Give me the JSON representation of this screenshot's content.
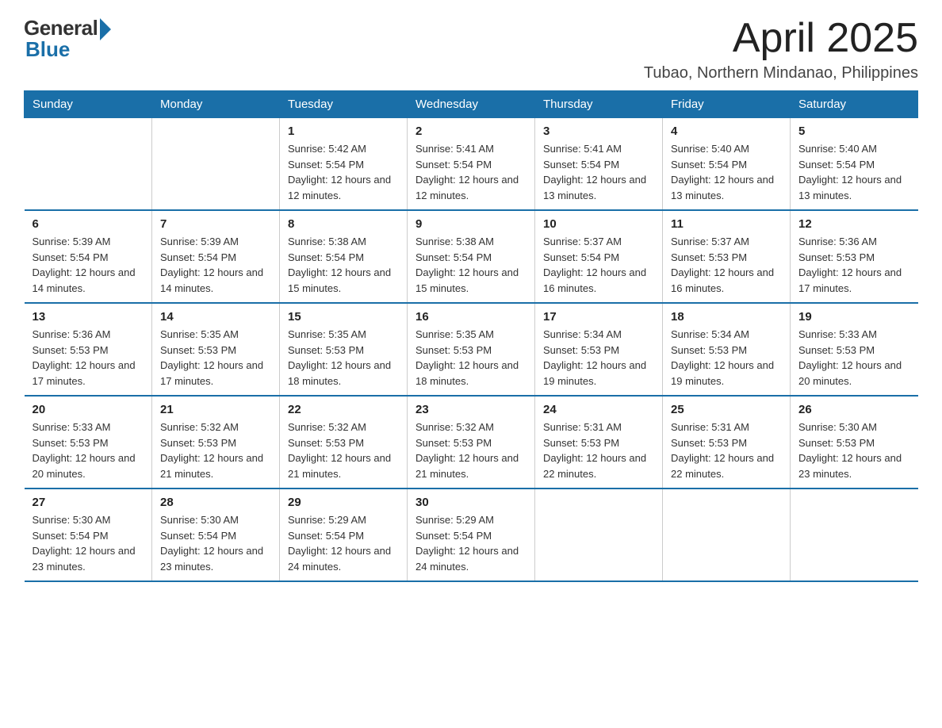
{
  "logo": {
    "general": "General",
    "blue": "Blue"
  },
  "header": {
    "title": "April 2025",
    "location": "Tubao, Northern Mindanao, Philippines"
  },
  "days_of_week": [
    "Sunday",
    "Monday",
    "Tuesday",
    "Wednesday",
    "Thursday",
    "Friday",
    "Saturday"
  ],
  "weeks": [
    [
      {
        "day": "",
        "sunrise": "",
        "sunset": "",
        "daylight": ""
      },
      {
        "day": "",
        "sunrise": "",
        "sunset": "",
        "daylight": ""
      },
      {
        "day": "1",
        "sunrise": "Sunrise: 5:42 AM",
        "sunset": "Sunset: 5:54 PM",
        "daylight": "Daylight: 12 hours and 12 minutes."
      },
      {
        "day": "2",
        "sunrise": "Sunrise: 5:41 AM",
        "sunset": "Sunset: 5:54 PM",
        "daylight": "Daylight: 12 hours and 12 minutes."
      },
      {
        "day": "3",
        "sunrise": "Sunrise: 5:41 AM",
        "sunset": "Sunset: 5:54 PM",
        "daylight": "Daylight: 12 hours and 13 minutes."
      },
      {
        "day": "4",
        "sunrise": "Sunrise: 5:40 AM",
        "sunset": "Sunset: 5:54 PM",
        "daylight": "Daylight: 12 hours and 13 minutes."
      },
      {
        "day": "5",
        "sunrise": "Sunrise: 5:40 AM",
        "sunset": "Sunset: 5:54 PM",
        "daylight": "Daylight: 12 hours and 13 minutes."
      }
    ],
    [
      {
        "day": "6",
        "sunrise": "Sunrise: 5:39 AM",
        "sunset": "Sunset: 5:54 PM",
        "daylight": "Daylight: 12 hours and 14 minutes."
      },
      {
        "day": "7",
        "sunrise": "Sunrise: 5:39 AM",
        "sunset": "Sunset: 5:54 PM",
        "daylight": "Daylight: 12 hours and 14 minutes."
      },
      {
        "day": "8",
        "sunrise": "Sunrise: 5:38 AM",
        "sunset": "Sunset: 5:54 PM",
        "daylight": "Daylight: 12 hours and 15 minutes."
      },
      {
        "day": "9",
        "sunrise": "Sunrise: 5:38 AM",
        "sunset": "Sunset: 5:54 PM",
        "daylight": "Daylight: 12 hours and 15 minutes."
      },
      {
        "day": "10",
        "sunrise": "Sunrise: 5:37 AM",
        "sunset": "Sunset: 5:54 PM",
        "daylight": "Daylight: 12 hours and 16 minutes."
      },
      {
        "day": "11",
        "sunrise": "Sunrise: 5:37 AM",
        "sunset": "Sunset: 5:53 PM",
        "daylight": "Daylight: 12 hours and 16 minutes."
      },
      {
        "day": "12",
        "sunrise": "Sunrise: 5:36 AM",
        "sunset": "Sunset: 5:53 PM",
        "daylight": "Daylight: 12 hours and 17 minutes."
      }
    ],
    [
      {
        "day": "13",
        "sunrise": "Sunrise: 5:36 AM",
        "sunset": "Sunset: 5:53 PM",
        "daylight": "Daylight: 12 hours and 17 minutes."
      },
      {
        "day": "14",
        "sunrise": "Sunrise: 5:35 AM",
        "sunset": "Sunset: 5:53 PM",
        "daylight": "Daylight: 12 hours and 17 minutes."
      },
      {
        "day": "15",
        "sunrise": "Sunrise: 5:35 AM",
        "sunset": "Sunset: 5:53 PM",
        "daylight": "Daylight: 12 hours and 18 minutes."
      },
      {
        "day": "16",
        "sunrise": "Sunrise: 5:35 AM",
        "sunset": "Sunset: 5:53 PM",
        "daylight": "Daylight: 12 hours and 18 minutes."
      },
      {
        "day": "17",
        "sunrise": "Sunrise: 5:34 AM",
        "sunset": "Sunset: 5:53 PM",
        "daylight": "Daylight: 12 hours and 19 minutes."
      },
      {
        "day": "18",
        "sunrise": "Sunrise: 5:34 AM",
        "sunset": "Sunset: 5:53 PM",
        "daylight": "Daylight: 12 hours and 19 minutes."
      },
      {
        "day": "19",
        "sunrise": "Sunrise: 5:33 AM",
        "sunset": "Sunset: 5:53 PM",
        "daylight": "Daylight: 12 hours and 20 minutes."
      }
    ],
    [
      {
        "day": "20",
        "sunrise": "Sunrise: 5:33 AM",
        "sunset": "Sunset: 5:53 PM",
        "daylight": "Daylight: 12 hours and 20 minutes."
      },
      {
        "day": "21",
        "sunrise": "Sunrise: 5:32 AM",
        "sunset": "Sunset: 5:53 PM",
        "daylight": "Daylight: 12 hours and 21 minutes."
      },
      {
        "day": "22",
        "sunrise": "Sunrise: 5:32 AM",
        "sunset": "Sunset: 5:53 PM",
        "daylight": "Daylight: 12 hours and 21 minutes."
      },
      {
        "day": "23",
        "sunrise": "Sunrise: 5:32 AM",
        "sunset": "Sunset: 5:53 PM",
        "daylight": "Daylight: 12 hours and 21 minutes."
      },
      {
        "day": "24",
        "sunrise": "Sunrise: 5:31 AM",
        "sunset": "Sunset: 5:53 PM",
        "daylight": "Daylight: 12 hours and 22 minutes."
      },
      {
        "day": "25",
        "sunrise": "Sunrise: 5:31 AM",
        "sunset": "Sunset: 5:53 PM",
        "daylight": "Daylight: 12 hours and 22 minutes."
      },
      {
        "day": "26",
        "sunrise": "Sunrise: 5:30 AM",
        "sunset": "Sunset: 5:53 PM",
        "daylight": "Daylight: 12 hours and 23 minutes."
      }
    ],
    [
      {
        "day": "27",
        "sunrise": "Sunrise: 5:30 AM",
        "sunset": "Sunset: 5:54 PM",
        "daylight": "Daylight: 12 hours and 23 minutes."
      },
      {
        "day": "28",
        "sunrise": "Sunrise: 5:30 AM",
        "sunset": "Sunset: 5:54 PM",
        "daylight": "Daylight: 12 hours and 23 minutes."
      },
      {
        "day": "29",
        "sunrise": "Sunrise: 5:29 AM",
        "sunset": "Sunset: 5:54 PM",
        "daylight": "Daylight: 12 hours and 24 minutes."
      },
      {
        "day": "30",
        "sunrise": "Sunrise: 5:29 AM",
        "sunset": "Sunset: 5:54 PM",
        "daylight": "Daylight: 12 hours and 24 minutes."
      },
      {
        "day": "",
        "sunrise": "",
        "sunset": "",
        "daylight": ""
      },
      {
        "day": "",
        "sunrise": "",
        "sunset": "",
        "daylight": ""
      },
      {
        "day": "",
        "sunrise": "",
        "sunset": "",
        "daylight": ""
      }
    ]
  ]
}
